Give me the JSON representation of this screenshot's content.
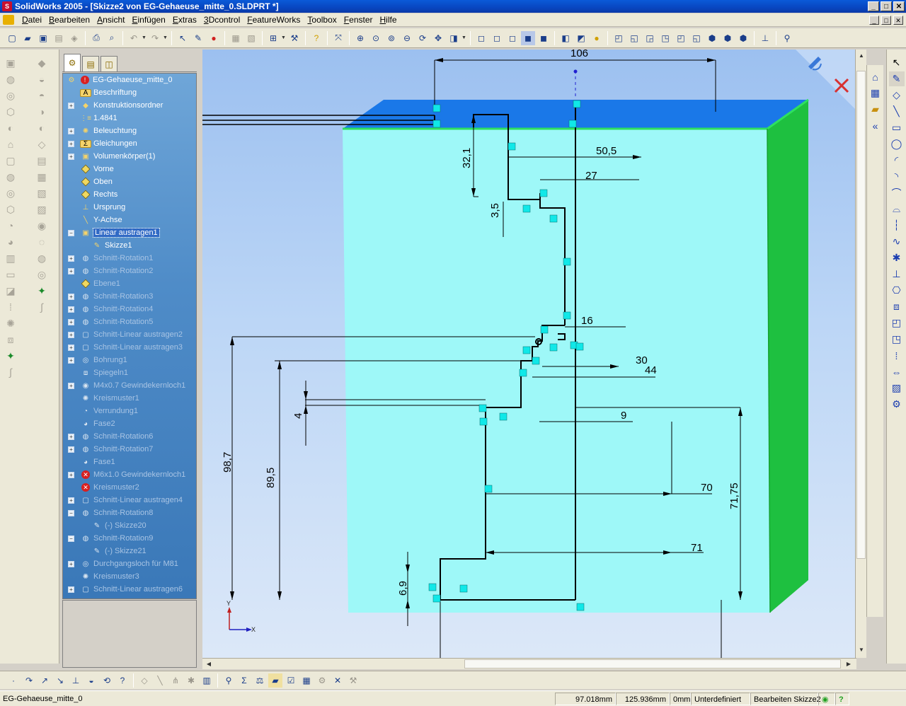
{
  "window": {
    "title": "SolidWorks 2005 - [Skizze2 von EG-Gehaeuse_mitte_0.SLDPRT *]",
    "minimize": "_",
    "maximize": "□",
    "close": "✕"
  },
  "menu": {
    "items": [
      "Datei",
      "Bearbeiten",
      "Ansicht",
      "Einfügen",
      "Extras",
      "3Dcontrol",
      "FeatureWorks",
      "Toolbox",
      "Fenster",
      "Hilfe"
    ]
  },
  "tree": {
    "root": "EG-Gehaeuse_mitte_0",
    "items": [
      {
        "label": "Beschriftung",
        "icon": "annotation-icon",
        "expandable": false,
        "suppressed": false
      },
      {
        "label": "Konstruktionsordner",
        "icon": "design-binder-icon",
        "expandable": true,
        "suppressed": false
      },
      {
        "label": "1.4841",
        "icon": "material-icon",
        "expandable": false,
        "suppressed": false
      },
      {
        "label": "Beleuchtung",
        "icon": "lighting-icon",
        "expandable": true,
        "suppressed": false
      },
      {
        "label": "Gleichungen",
        "icon": "equations-icon",
        "expandable": true,
        "suppressed": false
      },
      {
        "label": "Volumenkörper(1)",
        "icon": "solid-bodies-icon",
        "expandable": true,
        "suppressed": false
      },
      {
        "label": "Vorne",
        "icon": "plane-icon",
        "expandable": false,
        "suppressed": false
      },
      {
        "label": "Oben",
        "icon": "plane-icon",
        "expandable": false,
        "suppressed": false
      },
      {
        "label": "Rechts",
        "icon": "plane-icon",
        "expandable": false,
        "suppressed": false
      },
      {
        "label": "Ursprung",
        "icon": "origin-icon",
        "expandable": false,
        "suppressed": false
      },
      {
        "label": "Y-Achse",
        "icon": "axis-icon",
        "expandable": false,
        "suppressed": false
      },
      {
        "label": "Linear austragen1",
        "icon": "extrude-icon",
        "expandable": true,
        "suppressed": false,
        "selected": true
      },
      {
        "label": "Skizze1",
        "icon": "sketch-icon",
        "expandable": false,
        "suppressed": false,
        "child": true
      },
      {
        "label": "Schnitt-Rotation1",
        "icon": "revolve-cut-icon",
        "expandable": true,
        "suppressed": true
      },
      {
        "label": "Schnitt-Rotation2",
        "icon": "revolve-cut-icon",
        "expandable": true,
        "suppressed": true
      },
      {
        "label": "Ebene1",
        "icon": "plane-icon",
        "expandable": false,
        "suppressed": true
      },
      {
        "label": "Schnitt-Rotation3",
        "icon": "revolve-cut-icon",
        "expandable": true,
        "suppressed": true
      },
      {
        "label": "Schnitt-Rotation4",
        "icon": "revolve-cut-icon",
        "expandable": true,
        "suppressed": true
      },
      {
        "label": "Schnitt-Rotation5",
        "icon": "revolve-cut-icon",
        "expandable": true,
        "suppressed": true
      },
      {
        "label": "Schnitt-Linear austragen2",
        "icon": "extrude-cut-icon",
        "expandable": true,
        "suppressed": true
      },
      {
        "label": "Schnitt-Linear austragen3",
        "icon": "extrude-cut-icon",
        "expandable": true,
        "suppressed": true
      },
      {
        "label": "Bohrung1",
        "icon": "hole-icon",
        "expandable": true,
        "suppressed": true
      },
      {
        "label": "Spiegeln1",
        "icon": "mirror-icon",
        "expandable": false,
        "suppressed": true
      },
      {
        "label": "M4x0.7 Gewindekernloch1",
        "icon": "hole-wizard-icon",
        "expandable": true,
        "suppressed": true
      },
      {
        "label": "Kreismuster1",
        "icon": "circular-pattern-icon",
        "expandable": false,
        "suppressed": true
      },
      {
        "label": "Verrundung1",
        "icon": "fillet-icon",
        "expandable": false,
        "suppressed": true
      },
      {
        "label": "Fase2",
        "icon": "chamfer-icon",
        "expandable": false,
        "suppressed": true
      },
      {
        "label": "Schnitt-Rotation6",
        "icon": "revolve-cut-icon",
        "expandable": true,
        "suppressed": true
      },
      {
        "label": "Schnitt-Rotation7",
        "icon": "revolve-cut-icon",
        "expandable": true,
        "suppressed": true
      },
      {
        "label": "Fase1",
        "icon": "chamfer-icon",
        "expandable": false,
        "suppressed": true
      },
      {
        "label": "M6x1.0 Gewindekernloch1",
        "icon": "error-icon",
        "expandable": true,
        "suppressed": true
      },
      {
        "label": "Kreismuster2",
        "icon": "error-icon",
        "expandable": false,
        "suppressed": true
      },
      {
        "label": "Schnitt-Linear austragen4",
        "icon": "extrude-cut-icon",
        "expandable": true,
        "suppressed": true
      },
      {
        "label": "Schnitt-Rotation8",
        "icon": "revolve-cut-icon",
        "expandable": true,
        "suppressed": true,
        "open": true
      },
      {
        "label": "(-) Skizze20",
        "icon": "sketch-icon",
        "expandable": false,
        "suppressed": true,
        "child": true
      },
      {
        "label": "Schnitt-Rotation9",
        "icon": "revolve-cut-icon",
        "expandable": true,
        "suppressed": true,
        "open": true
      },
      {
        "label": "(-) Skizze21",
        "icon": "sketch-icon",
        "expandable": false,
        "suppressed": true,
        "child": true
      },
      {
        "label": "Durchgangsloch für M81",
        "icon": "hole-icon",
        "expandable": true,
        "suppressed": true
      },
      {
        "label": "Kreismuster3",
        "icon": "circular-pattern-icon",
        "expandable": false,
        "suppressed": true
      },
      {
        "label": "Schnitt-Linear austragen6",
        "icon": "extrude-cut-icon",
        "expandable": true,
        "suppressed": true
      }
    ]
  },
  "dimensions": {
    "d106": "106",
    "d50_5": "50,5",
    "d32_1": "32,1",
    "d27": "27",
    "d3_5": "3,5",
    "d16": "16",
    "d30": "30",
    "d44": "44",
    "d4": "4",
    "d9": "9",
    "d98_7": "98,7",
    "d89_5": "89,5",
    "d70": "70",
    "d71_75": "71,75",
    "d71": "71",
    "d6_9": "6,9"
  },
  "triad": {
    "x": "X",
    "y": "Y"
  },
  "status": {
    "file": "EG-Gehaeuse_mitte_0",
    "x": "97.018mm",
    "y": "125.936mm",
    "z": "0mm",
    "state": "Unterdefiniert",
    "mode": "Bearbeiten Skizze2",
    "help": "?"
  },
  "colors": {
    "face_front": "#9ef8f8",
    "face_top": "#1a78e8",
    "face_side": "#1ec040",
    "edge_green": "#2ee060",
    "sketch_line": "#000000",
    "relation_marker": "#10e8e8"
  }
}
